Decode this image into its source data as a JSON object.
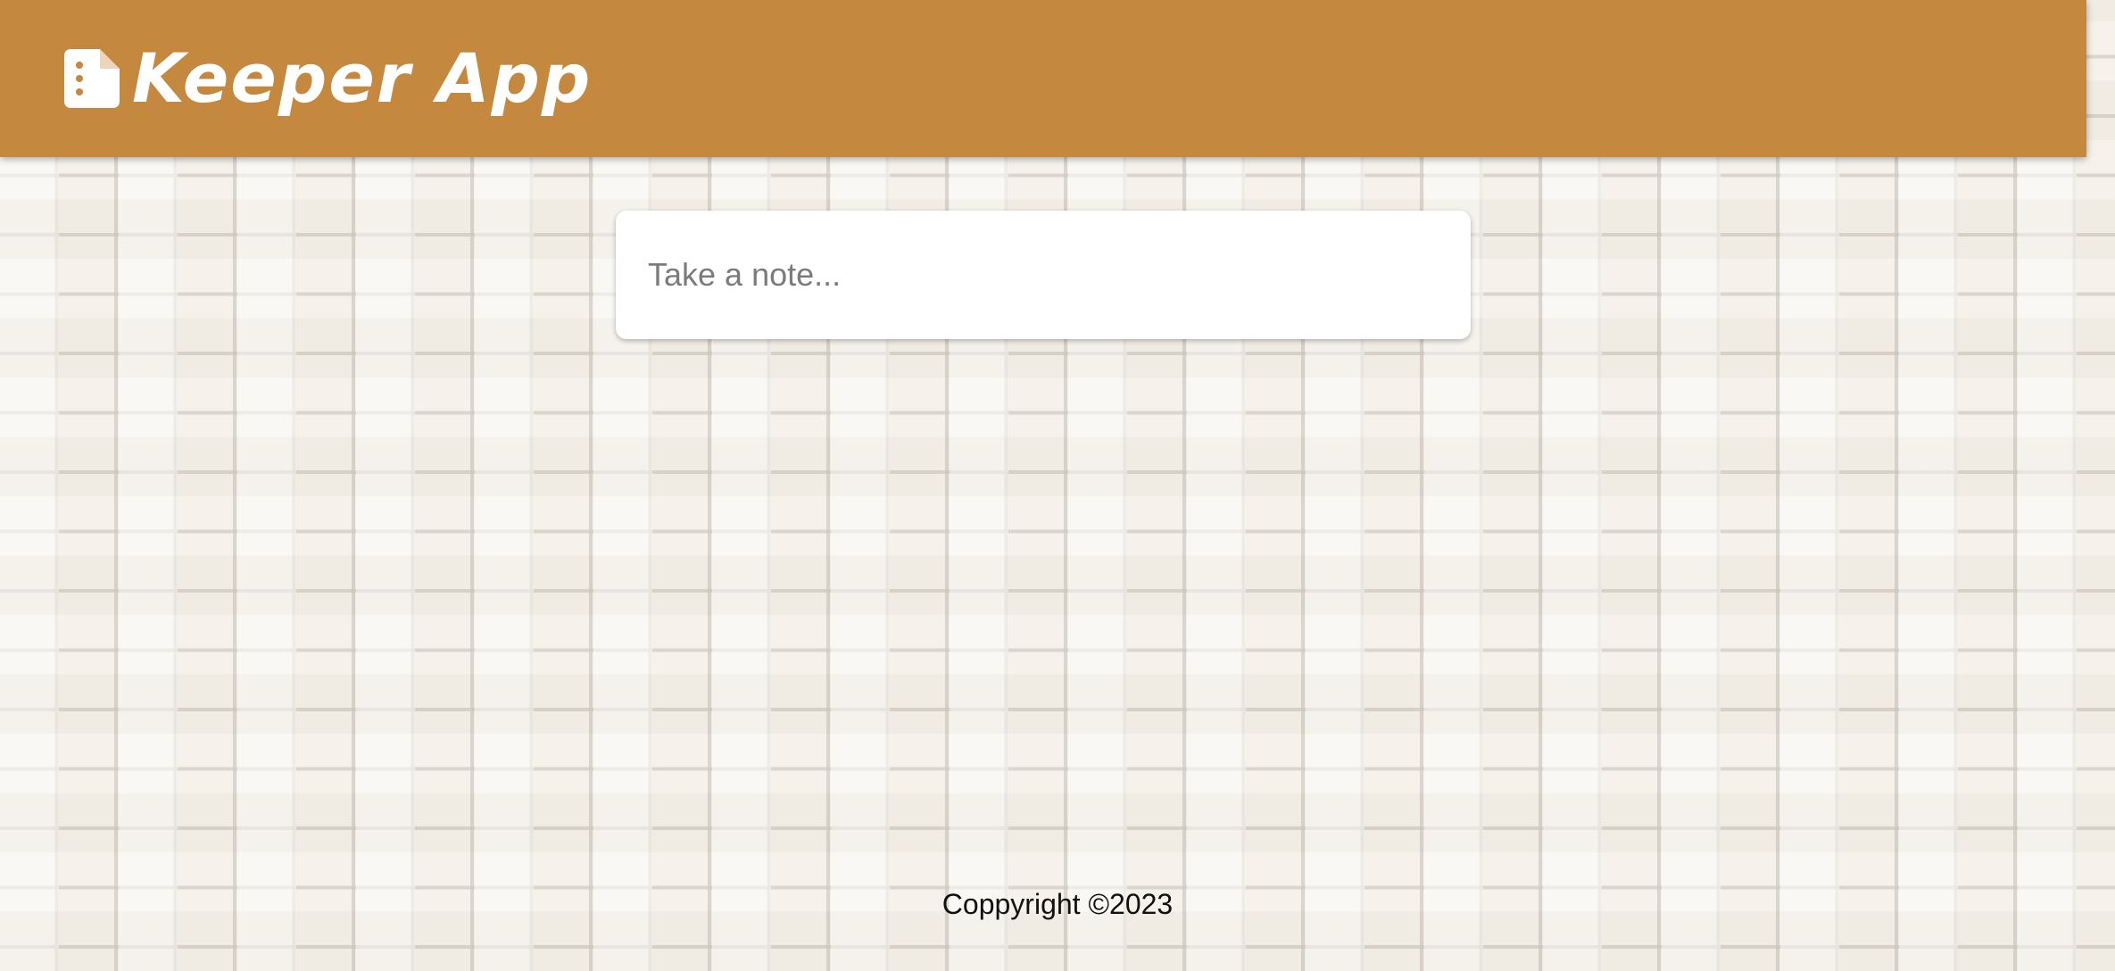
{
  "header": {
    "title": "Keeper App",
    "icon": "note-icon",
    "background_color": "#c5883f"
  },
  "note_input": {
    "placeholder": "Take a note...",
    "value": ""
  },
  "footer": {
    "copyright": "Coppyright ©2023"
  },
  "colors": {
    "page_background": "#f7f4ee",
    "header_text": "#ffffff"
  }
}
